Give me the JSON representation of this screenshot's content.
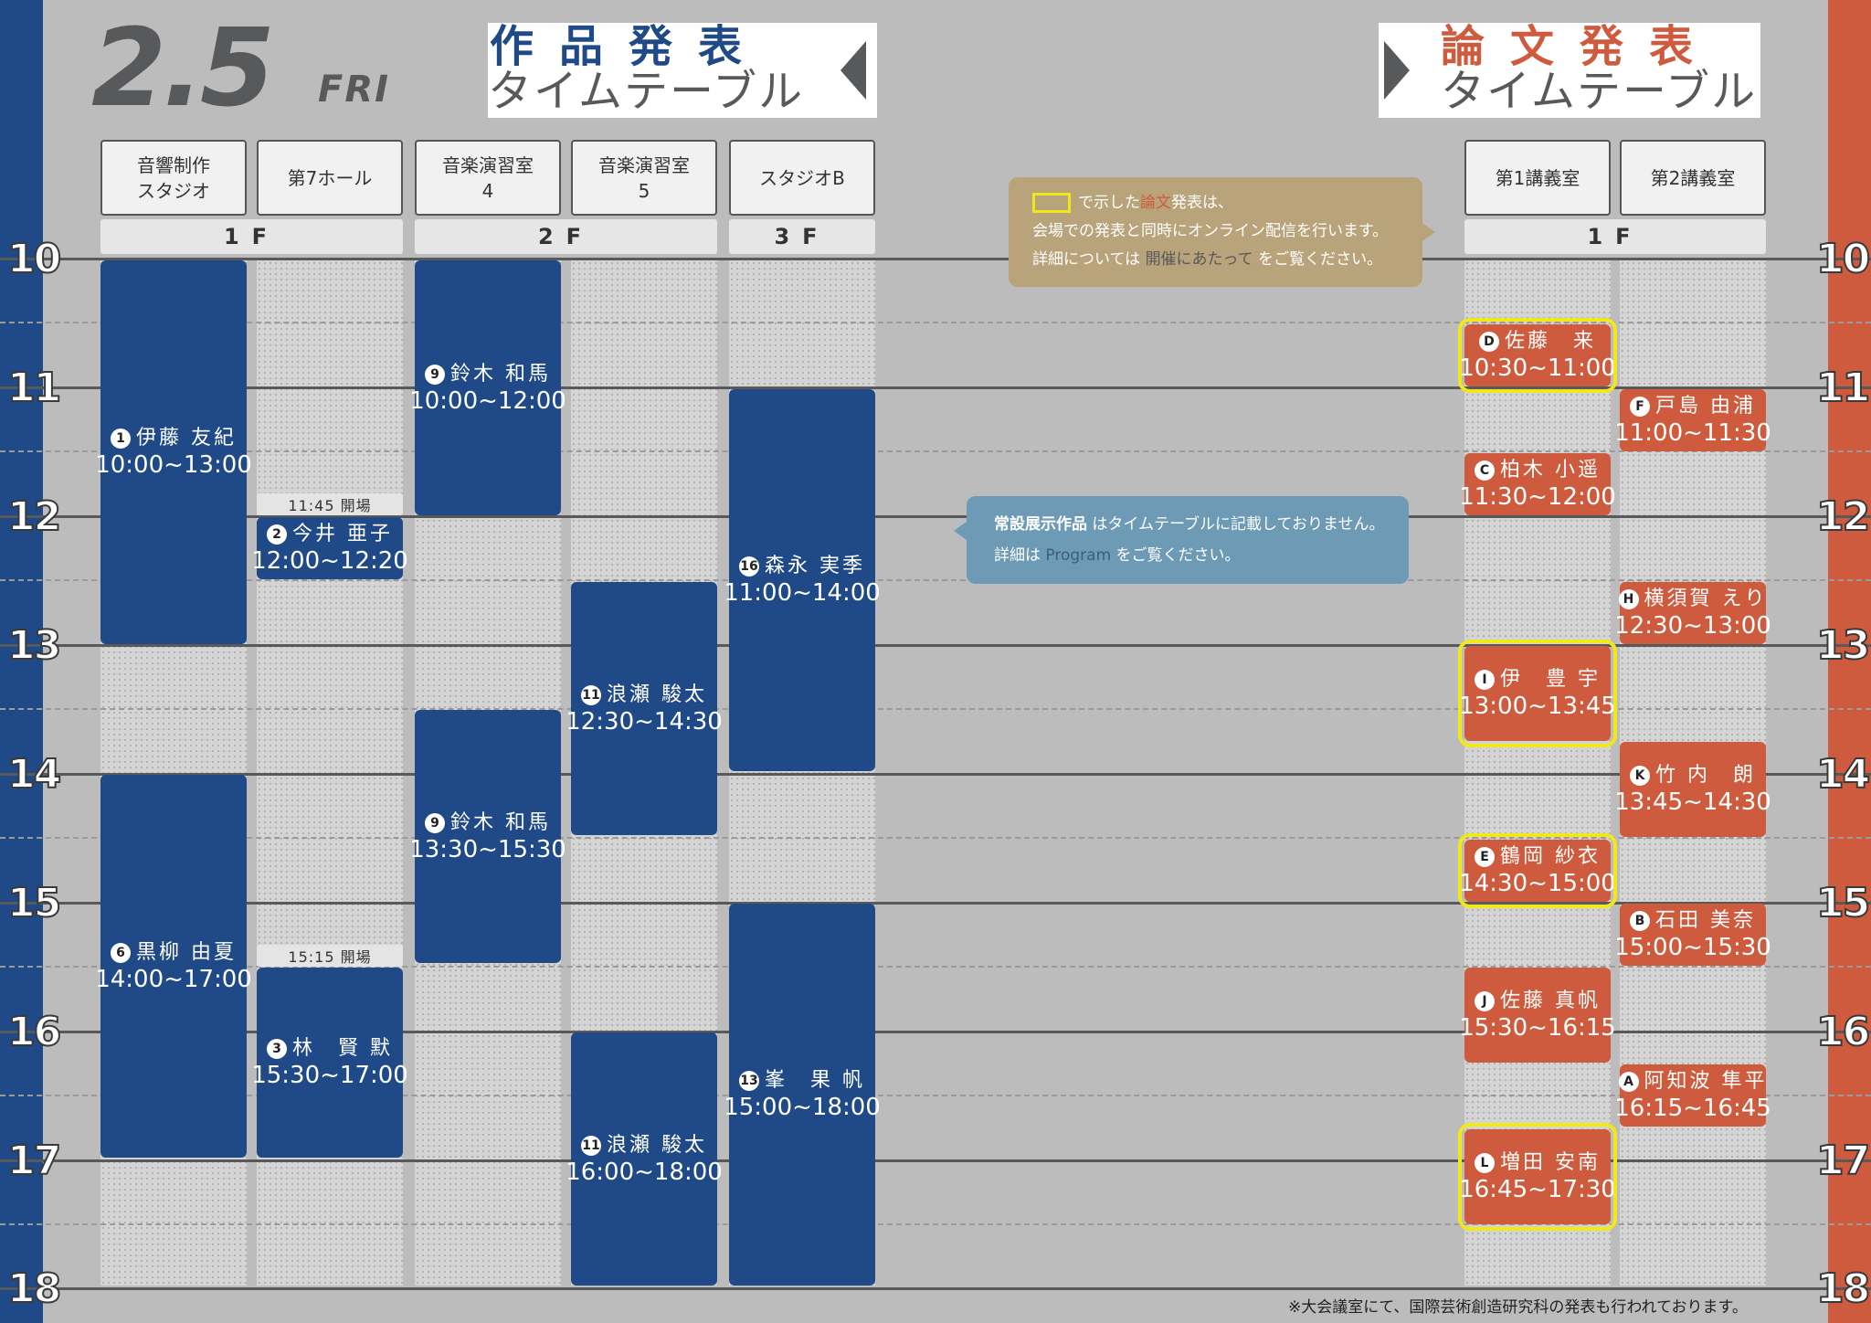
{
  "header": {
    "date": "2.5",
    "day": "FRI",
    "works_title_1": "作品発表",
    "works_title_2": "タイムテーブル",
    "papers_title_1": "論文発表",
    "papers_title_2": "タイムテーブル"
  },
  "hours": [
    "10",
    "11",
    "12",
    "13",
    "14",
    "15",
    "16",
    "17",
    "18"
  ],
  "rooms": {
    "r1": "音響制作\nスタジオ",
    "r2": "第7ホール",
    "r3": "音楽演習室\n4",
    "r4": "音楽演習室\n5",
    "r5": "スタジオB",
    "r6": "第1講義室",
    "r7": "第2講義室"
  },
  "floors": {
    "f1": "1F",
    "f2": "2F",
    "f3": "3F",
    "f4": "1F"
  },
  "events": {
    "e1": {
      "badge": "1",
      "name": "伊藤 友紀",
      "time": "10:00~13:00"
    },
    "e2": {
      "badge": "2",
      "name": "今井 亜子",
      "time": "12:00~12:20"
    },
    "e3": {
      "badge": "3",
      "name": "林　賢 默",
      "time": "15:30~17:00"
    },
    "e4": {
      "badge": "6",
      "name": "黒柳 由夏",
      "time": "14:00~17:00"
    },
    "e5": {
      "badge": "9",
      "name": "鈴木 和馬",
      "time": "10:00~12:00"
    },
    "e6": {
      "badge": "9",
      "name": "鈴木 和馬",
      "time": "13:30~15:30"
    },
    "e7": {
      "badge": "11",
      "name": "浪瀬 駿太",
      "time": "12:30~14:30"
    },
    "e8": {
      "badge": "11",
      "name": "浪瀬 駿太",
      "time": "16:00~18:00"
    },
    "e9": {
      "badge": "16",
      "name": "森永 実季",
      "time": "11:00~14:00"
    },
    "e10": {
      "badge": "13",
      "name": "峯　果 帆",
      "time": "15:00~18:00"
    },
    "p1": {
      "badge": "D",
      "name": "佐藤　来",
      "time": "10:30~11:00"
    },
    "p2": {
      "badge": "C",
      "name": "柏木 小遥",
      "time": "11:30~12:00"
    },
    "p3": {
      "badge": "I",
      "name": "伊　豊 宇",
      "time": "13:00~13:45"
    },
    "p4": {
      "badge": "E",
      "name": "鶴岡 紗衣",
      "time": "14:30~15:00"
    },
    "p5": {
      "badge": "J",
      "name": "佐藤 真帆",
      "time": "15:30~16:15"
    },
    "p6": {
      "badge": "L",
      "name": "増田 安南",
      "time": "16:45~17:30"
    },
    "p7": {
      "badge": "F",
      "name": "戸島 由浦",
      "time": "11:00~11:30"
    },
    "p8": {
      "badge": "H",
      "name": "横須賀 えり",
      "time": "12:30~13:00"
    },
    "p9": {
      "badge": "K",
      "name": "竹 内　朗",
      "time": "13:45~14:30"
    },
    "p10": {
      "badge": "B",
      "name": "石田 美奈",
      "time": "15:00~15:30"
    },
    "p11": {
      "badge": "A",
      "name": "阿知波 隼平",
      "time": "16:15~16:45"
    }
  },
  "openings": {
    "o1": "11:45 開場",
    "o2": "15:15 開場"
  },
  "notes": {
    "gold_line1_a": "で示した",
    "gold_line1_b": "論文",
    "gold_line1_c": "発表は、",
    "gold_line2": "会場での発表と同時にオンライン配信を行います。",
    "gold_line3_a": "詳細については",
    "gold_line3_b": "開催にあたって",
    "gold_line3_c": "をご覧ください。",
    "blue_line1_a": "常設展示作品",
    "blue_line1_b": "はタイムテーブルに記載しておりません。",
    "blue_line2_a": "詳細は",
    "blue_line2_b": "Program",
    "blue_line2_c": "をご覧ください。"
  },
  "footer": "※大会議室にて、国際芸術創造研究科の発表も行われております。",
  "colors": {
    "works_blue": "#1f4a87",
    "papers_orange": "#cf5b3e",
    "highlight_yellow": "#f0e81a",
    "note_gold": "#b9a37a",
    "note_blue": "#6d9ab4"
  }
}
